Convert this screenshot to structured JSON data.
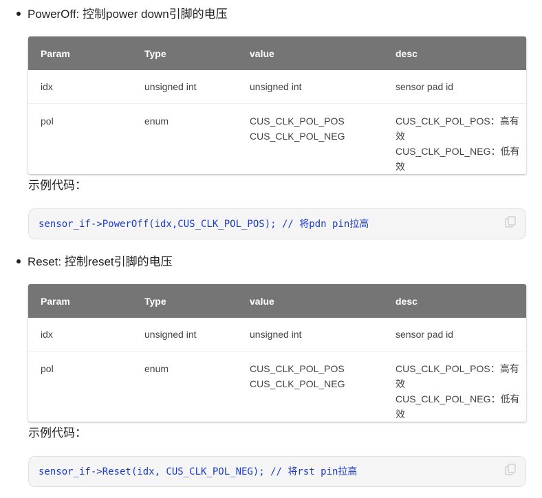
{
  "sections": [
    {
      "heading": "PowerOff: 控制power down引脚的电压",
      "table": {
        "headers": [
          "Param",
          "Type",
          "value",
          "desc"
        ],
        "rows": [
          {
            "param": "idx",
            "type": "unsigned int",
            "value": [
              "unsigned int"
            ],
            "desc": [
              "sensor pad id"
            ]
          },
          {
            "param": "pol",
            "type": "enum",
            "value": [
              "CUS_CLK_POL_POS",
              "CUS_CLK_POL_NEG"
            ],
            "desc": [
              "CUS_CLK_POL_POS：高有效",
              "CUS_CLK_POL_NEG：低有效"
            ]
          }
        ]
      },
      "example_label": "示例代码：",
      "code": "sensor_if->PowerOff(idx,CUS_CLK_POL_POS); // 将pdn pin拉高"
    },
    {
      "heading": "Reset: 控制reset引脚的电压",
      "table": {
        "headers": [
          "Param",
          "Type",
          "value",
          "desc"
        ],
        "rows": [
          {
            "param": "idx",
            "type": "unsigned int",
            "value": [
              "unsigned int"
            ],
            "desc": [
              "sensor pad id"
            ]
          },
          {
            "param": "pol",
            "type": "enum",
            "value": [
              "CUS_CLK_POL_POS",
              "CUS_CLK_POL_NEG"
            ],
            "desc": [
              "CUS_CLK_POL_POS：高有效",
              "CUS_CLK_POL_NEG：低有效"
            ]
          }
        ]
      },
      "example_label": "示例代码：",
      "code": "sensor_if->Reset(idx, CUS_CLK_POL_NEG); // 将rst pin拉高"
    }
  ],
  "icons": {
    "copy": "copy-icon"
  },
  "colors": {
    "table_header_bg": "#757575",
    "code_text": "#1a3bc9",
    "code_bg": "#f5f5f5"
  }
}
